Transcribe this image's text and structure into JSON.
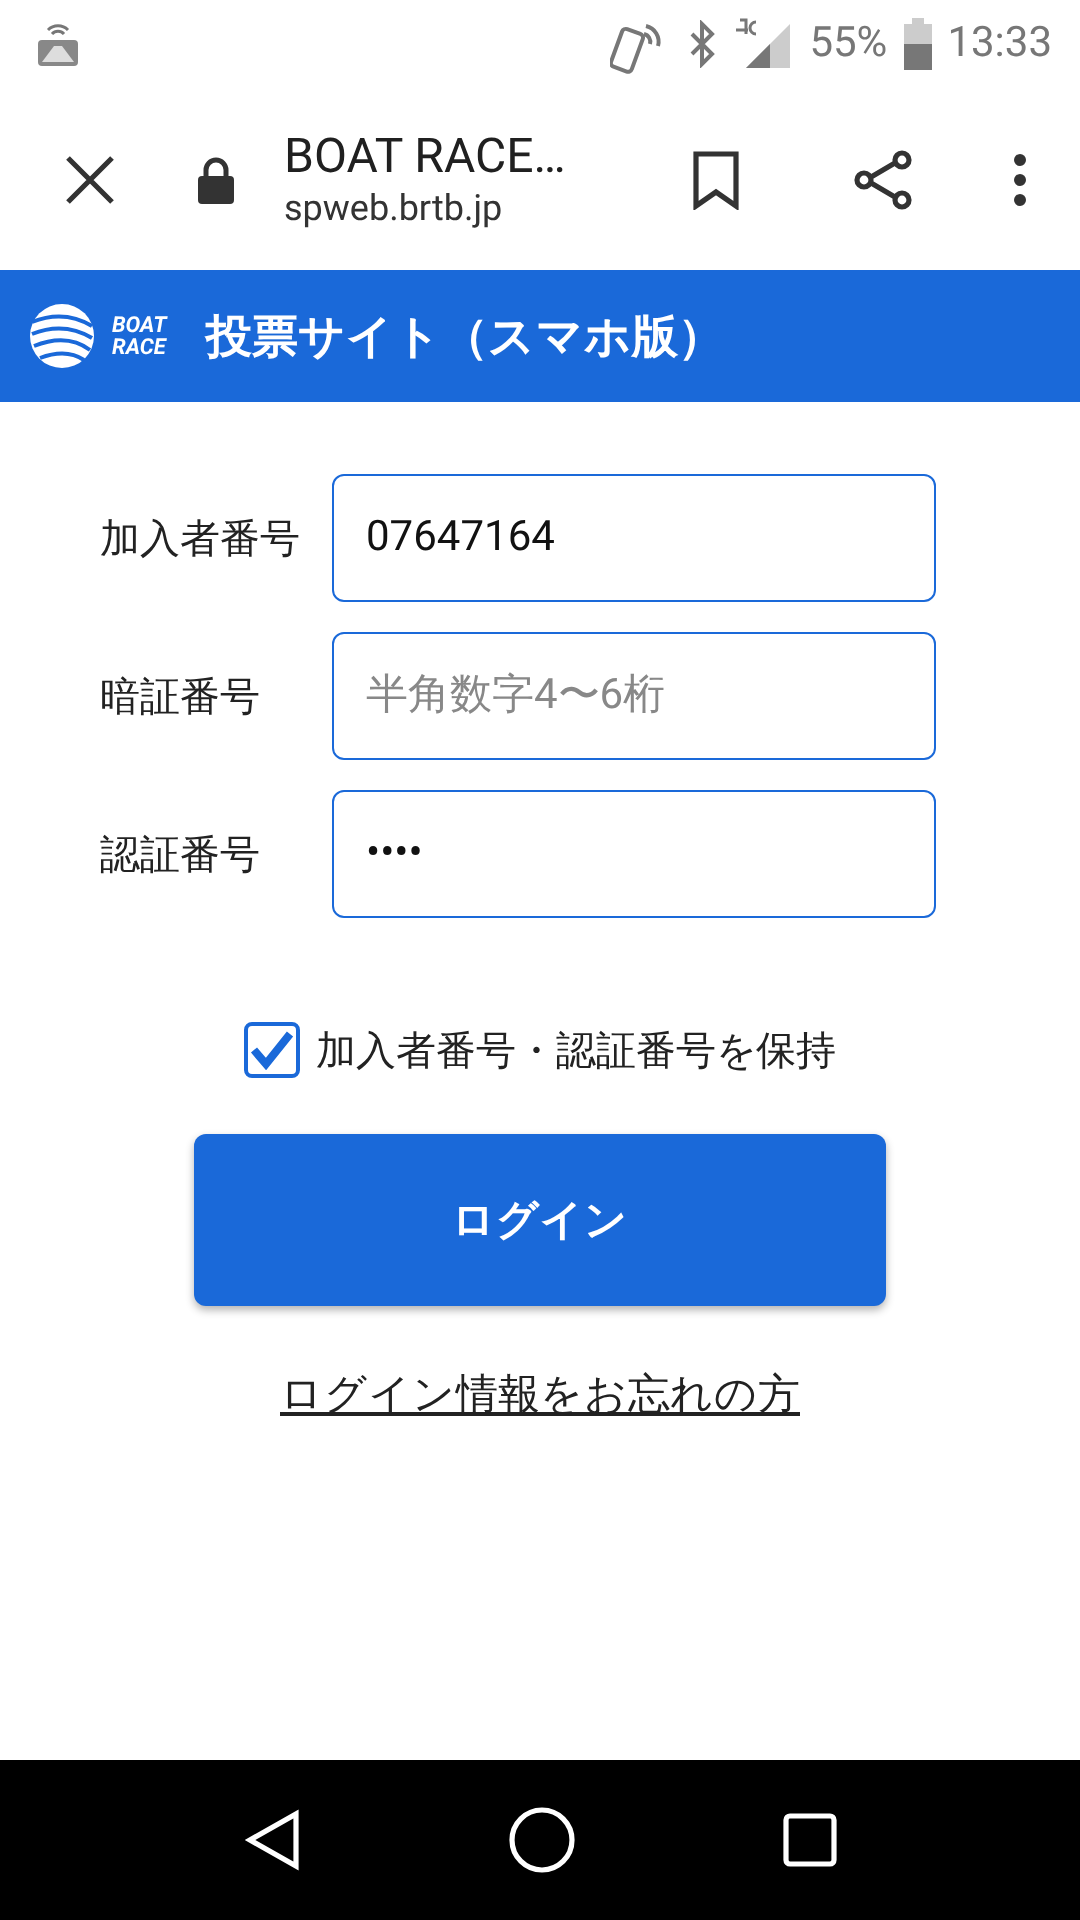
{
  "status_bar": {
    "battery": "55%",
    "time": "13:33"
  },
  "browser": {
    "title": "BOAT RACE…",
    "url": "spweb.brtb.jp"
  },
  "header": {
    "logo": [
      "BOAT",
      "RACE"
    ],
    "title": "投票サイト（スマホ版）"
  },
  "fields": [
    {
      "label": "加入者番号",
      "value": "07647164"
    },
    {
      "label": "暗証番号",
      "placeholder": "半角数字4〜6桁"
    },
    {
      "label": "認証番号",
      "value": "••••"
    }
  ],
  "remember": {
    "label": "加入者番号・認証番号を保持",
    "checked": true
  },
  "login_button": "ログイン",
  "forgot_link": "ログイン情報をお忘れの方"
}
